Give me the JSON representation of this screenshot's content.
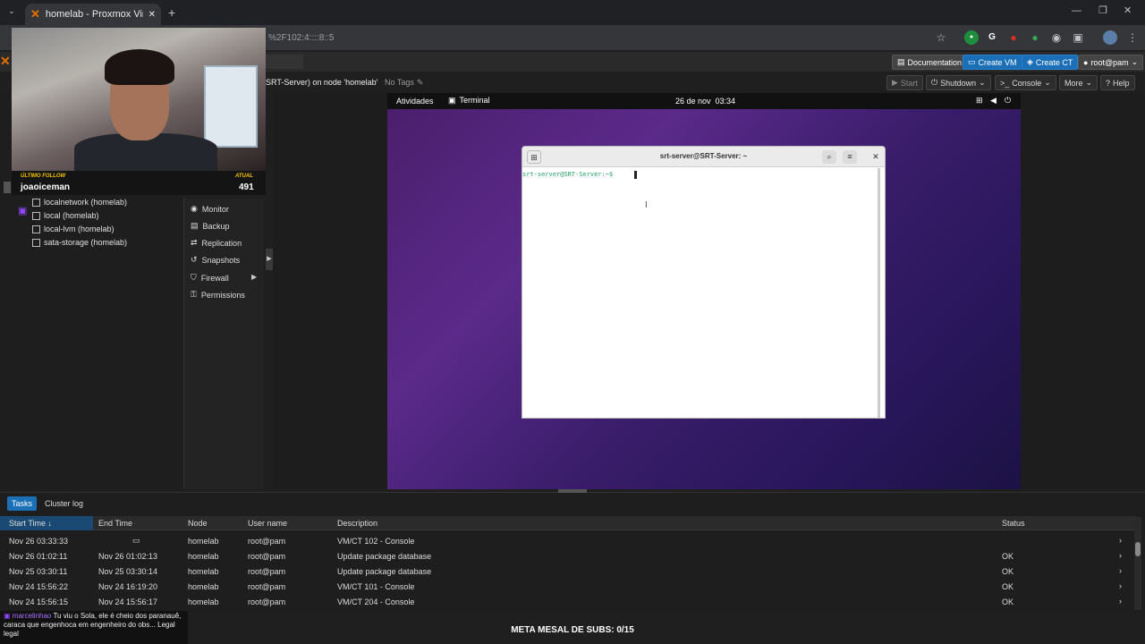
{
  "browser": {
    "tab_title": "homelab - Proxmox Virtual Env",
    "url": "%2F102:4::::8::5"
  },
  "pve_header": {
    "documentation": "Documentation",
    "create_vm": "Create VM",
    "create_ct": "Create CT",
    "user": "root@pam"
  },
  "toolbar": {
    "title": "SRT-Server) on node 'homelab'",
    "tags": "No Tags",
    "start": "Start",
    "shutdown": "Shutdown",
    "console": "Console",
    "more": "More",
    "help": "Help"
  },
  "tree": {
    "items": [
      "localnetwork (homelab)",
      "local (homelab)",
      "local-lvm (homelab)",
      "sata-storage (homelab)"
    ]
  },
  "submenu": {
    "items": [
      "Monitor",
      "Backup",
      "Replication",
      "Snapshots",
      "Firewall",
      "Permissions"
    ]
  },
  "gnome": {
    "activities": "Atividades",
    "app": "Terminal",
    "clock": "26 de nov  03:34"
  },
  "terminal": {
    "title": "srt-server@SRT-Server: ~",
    "prompt": "srt-server@SRT-Server:~$"
  },
  "stream": {
    "follow_label": "ÚLTIMO FOLLOW",
    "follow_name": "joaoiceman",
    "atual_label": "ATUAL",
    "atual_value": "491",
    "meta": "META MESAL DE SUBS: 0/15",
    "chat_user": "marcelinhao",
    "chat_text": "Tu viu o Sola, ele é cheio dos paranauê, caraca que engenhoca em engenheiro do obs... Legal legal"
  },
  "tasks": {
    "tabs": [
      "Tasks",
      "Cluster log"
    ],
    "columns": [
      "Start Time",
      "End Time",
      "Node",
      "User name",
      "Description",
      "Status"
    ],
    "rows": [
      {
        "start": "Nov 26 03:33:33",
        "end": "",
        "node": "homelab",
        "user": "root@pam",
        "desc": "VM/CT 102 - Console",
        "status": ""
      },
      {
        "start": "Nov 26 01:02:11",
        "end": "Nov 26 01:02:13",
        "node": "homelab",
        "user": "root@pam",
        "desc": "Update package database",
        "status": "OK"
      },
      {
        "start": "Nov 25 03:30:11",
        "end": "Nov 25 03:30:14",
        "node": "homelab",
        "user": "root@pam",
        "desc": "Update package database",
        "status": "OK"
      },
      {
        "start": "Nov 24 15:56:22",
        "end": "Nov 24 16:19:20",
        "node": "homelab",
        "user": "root@pam",
        "desc": "VM/CT 101 - Console",
        "status": "OK"
      },
      {
        "start": "Nov 24 15:56:15",
        "end": "Nov 24 15:56:17",
        "node": "homelab",
        "user": "root@pam",
        "desc": "VM/CT 204 - Console",
        "status": "OK"
      }
    ]
  },
  "colors": {
    "accent": "#1a6fb6",
    "terminal_prompt": "#26a269",
    "proxmox_orange": "#e57000"
  }
}
